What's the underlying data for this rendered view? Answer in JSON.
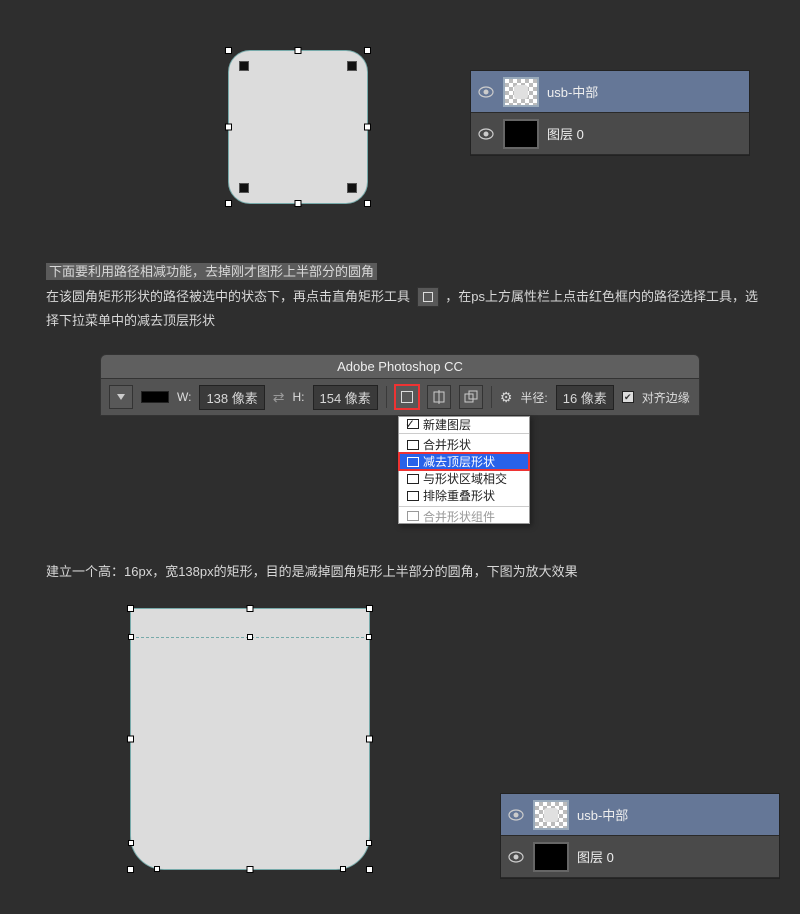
{
  "layers_panel_top": {
    "rows": [
      {
        "name": "usb-中部",
        "selected": true,
        "thumb": "checker"
      },
      {
        "name": "图层 0",
        "selected": false,
        "thumb": "black"
      }
    ]
  },
  "layers_panel_bottom": {
    "rows": [
      {
        "name": "usb-中部",
        "selected": true,
        "thumb": "checker"
      },
      {
        "name": "图层 0",
        "selected": false,
        "thumb": "black"
      }
    ]
  },
  "text1_highlight": "下面要利用路径相减功能，去掉刚才图形上半部分的圆角",
  "text1_line2a": "在该圆角矩形形状的路径被选中的状态下，再点击直角矩形工具",
  "text1_line2b": "，在ps上方属性栏上点击红色框内的路径选择工具，选择下拉菜单中的减去顶层形状",
  "optbar": {
    "title": "Adobe Photoshop CC",
    "w_label": "W:",
    "w_value": "138 像素",
    "h_label": "H:",
    "h_value": "154 像素",
    "radius_label": "半径:",
    "radius_value": "16 像素",
    "align_label": "对齐边缘"
  },
  "dropdown": {
    "items": [
      {
        "label": "新建图层",
        "checked": true
      },
      {
        "label": "合并形状"
      },
      {
        "label": "减去顶层形状",
        "selected": true
      },
      {
        "label": "与形状区域相交"
      },
      {
        "label": "排除重叠形状"
      },
      {
        "label": "合并形状组件",
        "disabled": true
      }
    ]
  },
  "text2": "建立一个高：16px，宽138px的矩形，目的是减掉圆角矩形上半部分的圆角，下图为放大效果"
}
